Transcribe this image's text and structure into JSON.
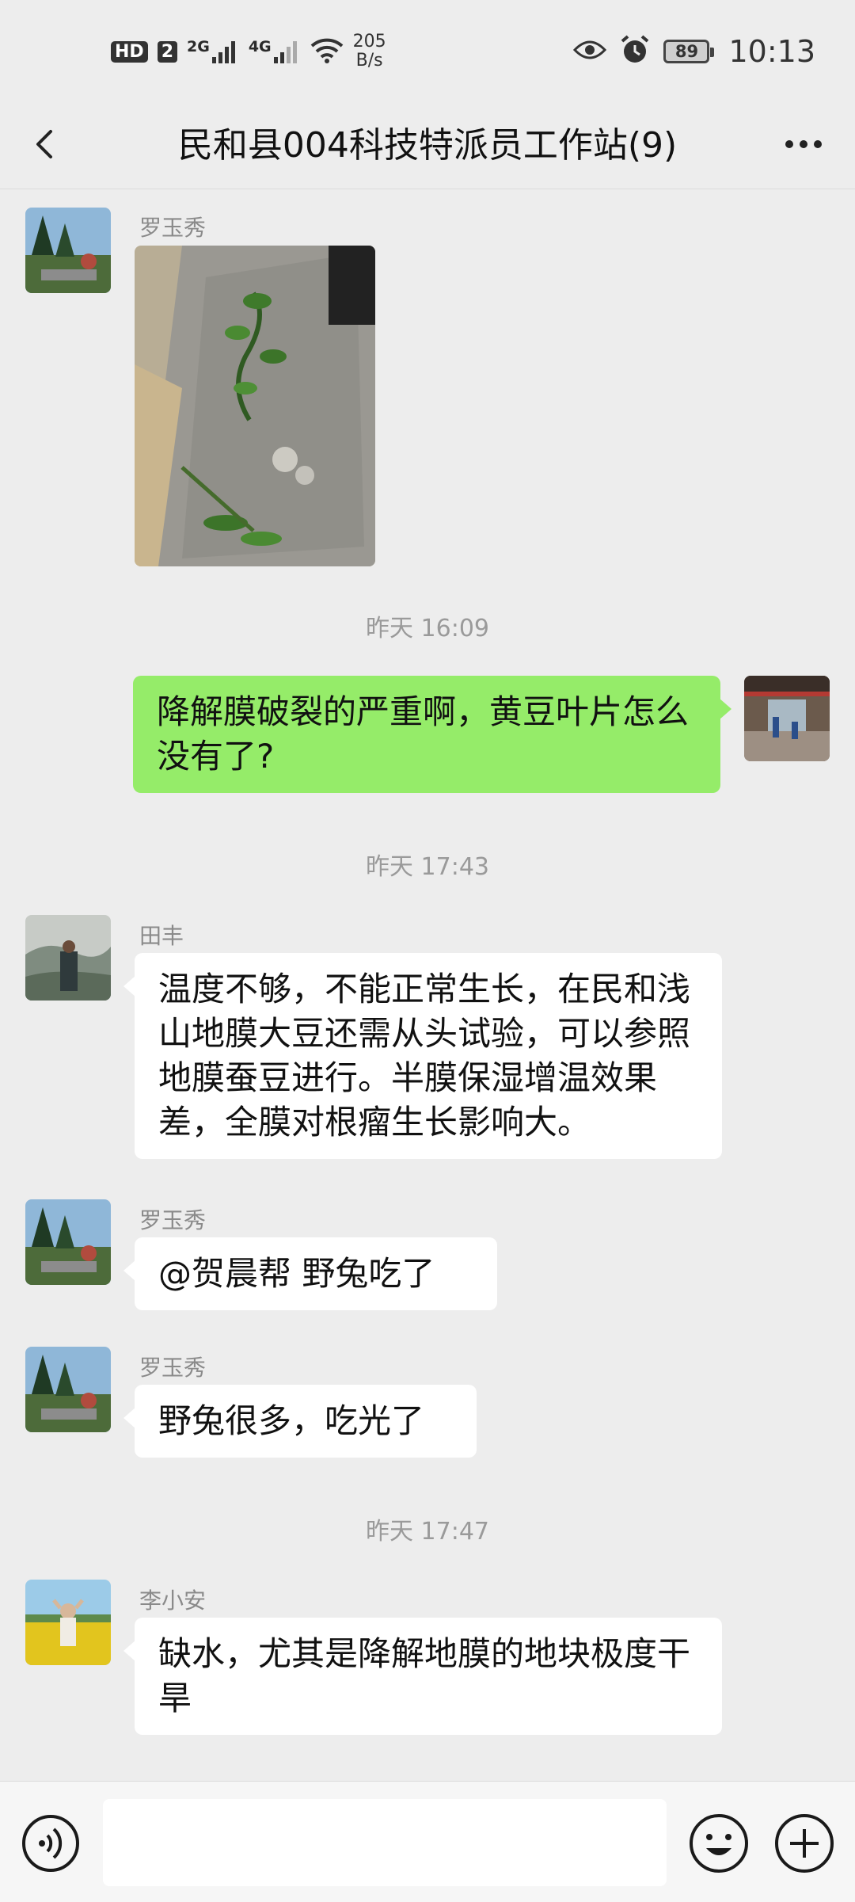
{
  "status_bar": {
    "hd": "HD",
    "sim": "2",
    "net1": "2G",
    "net2": "4G",
    "speed_value": "205",
    "speed_unit": "B/s",
    "battery": "89",
    "time": "10:13"
  },
  "header": {
    "title": "民和县004科技特派员工作站(9)"
  },
  "messages": [
    {
      "sender": "罗玉秀",
      "type": "image"
    },
    {
      "timestamp": "昨天 16:09"
    },
    {
      "type": "text",
      "self": true,
      "text": "降解膜破裂的严重啊，黄豆叶片怎么没有了?"
    },
    {
      "timestamp": "昨天 17:43"
    },
    {
      "sender": "田丰",
      "type": "text",
      "text": "温度不够，不能正常生长，在民和浅山地膜大豆还需从头试验，可以参照地膜蚕豆进行。半膜保湿增温效果差，全膜对根瘤生长影响大。"
    },
    {
      "sender": "罗玉秀",
      "type": "text",
      "text": "@贺晨帮  野兔吃了"
    },
    {
      "sender": "罗玉秀",
      "type": "text",
      "text": "野兔很多，吃光了"
    },
    {
      "timestamp": "昨天 17:47"
    },
    {
      "sender": "李小安",
      "type": "text",
      "text": "缺水，尤其是降解地膜的地块极度干旱"
    }
  ],
  "input": {
    "placeholder": ""
  },
  "colors": {
    "background": "#ededed",
    "self_bubble": "#95ec69",
    "other_bubble": "#ffffff"
  },
  "icons": [
    "back-arrow-icon",
    "more-dots-icon",
    "voice-icon",
    "emoji-icon",
    "plus-icon",
    "eye-icon",
    "alarm-icon",
    "wifi-icon"
  ]
}
